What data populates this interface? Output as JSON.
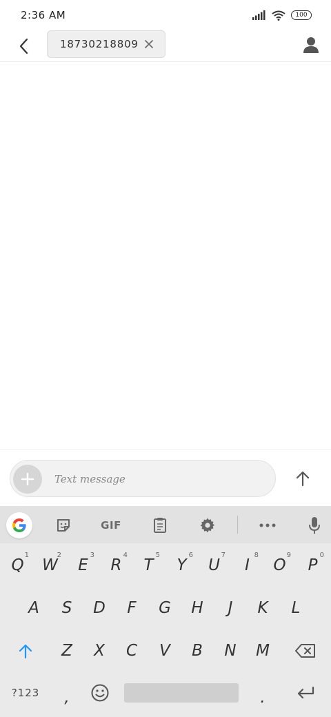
{
  "status_bar": {
    "time": "2:36 AM",
    "battery": "100",
    "icons": [
      "signal-icon",
      "wifi-icon",
      "battery-icon"
    ]
  },
  "app_bar": {
    "recipient": "18730218809",
    "icons": [
      "back-arrow-icon",
      "close-icon",
      "person-icon"
    ]
  },
  "compose": {
    "placeholder": "Text message",
    "icons": [
      "plus-icon",
      "send-arrow-icon"
    ]
  },
  "keyboard": {
    "toolbar": {
      "gif_label": "GIF",
      "icons": [
        "google-g-icon",
        "sticker-icon",
        "clipboard-icon",
        "gear-icon",
        "more-dots-icon",
        "mic-icon"
      ]
    },
    "row1": [
      {
        "key": "Q",
        "hint": "1"
      },
      {
        "key": "W",
        "hint": "2"
      },
      {
        "key": "E",
        "hint": "3"
      },
      {
        "key": "R",
        "hint": "4"
      },
      {
        "key": "T",
        "hint": "5"
      },
      {
        "key": "Y",
        "hint": "6"
      },
      {
        "key": "U",
        "hint": "7"
      },
      {
        "key": "I",
        "hint": "8"
      },
      {
        "key": "O",
        "hint": "9"
      },
      {
        "key": "P",
        "hint": "0"
      }
    ],
    "row2": [
      "A",
      "S",
      "D",
      "F",
      "G",
      "H",
      "J",
      "K",
      "L"
    ],
    "row3": [
      "Z",
      "X",
      "C",
      "V",
      "B",
      "N",
      "M"
    ],
    "row4": {
      "symbols_label": "?123",
      "comma": ",",
      "period": "."
    },
    "accent_color": "#2196f3"
  }
}
